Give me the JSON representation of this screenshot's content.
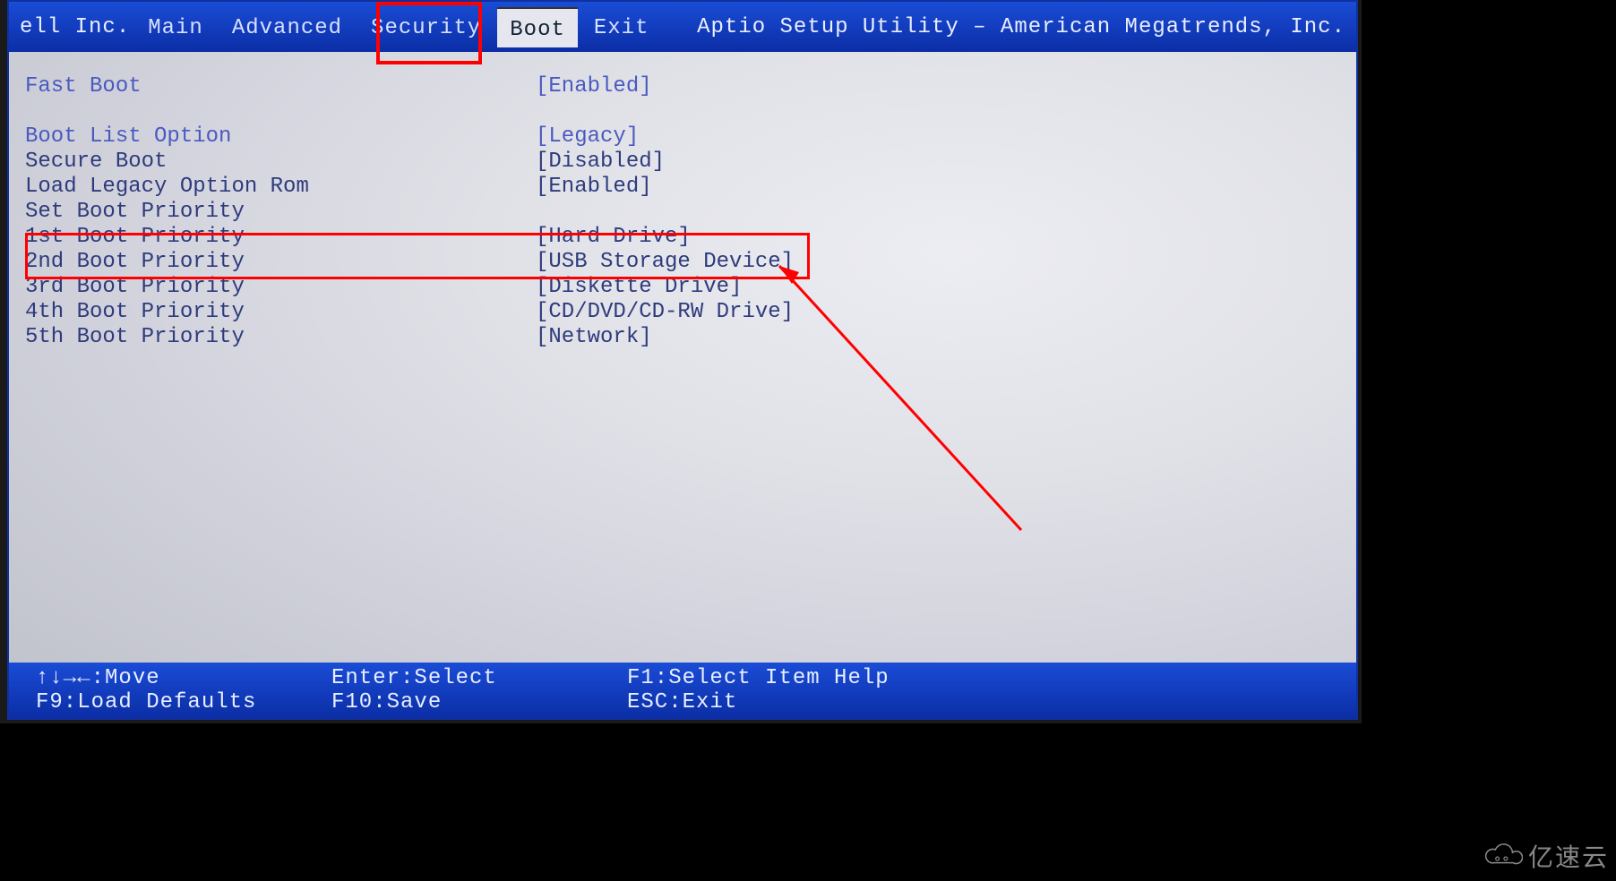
{
  "header": {
    "vendor": "ell Inc.",
    "title": "Aptio Setup Utility – American Megatrends, Inc.",
    "tabs": [
      {
        "label": "Main",
        "active": false
      },
      {
        "label": "Advanced",
        "active": false
      },
      {
        "label": "Security",
        "active": false
      },
      {
        "label": "Boot",
        "active": true
      },
      {
        "label": "Exit",
        "active": false
      }
    ]
  },
  "settings": [
    {
      "label": "Fast Boot",
      "value": "[Enabled]",
      "highlight": true
    },
    {
      "spacer": true
    },
    {
      "label": "Boot List Option",
      "value": "[Legacy]",
      "highlight": true
    },
    {
      "label": "Secure Boot",
      "value": "[Disabled]"
    },
    {
      "label": "Load Legacy Option Rom",
      "value": "[Enabled]"
    },
    {
      "label": "Set Boot Priority",
      "value": ""
    },
    {
      "label": "1st Boot Priority",
      "value": "[Hard Drive]"
    },
    {
      "label": "2nd Boot Priority",
      "value": "[USB Storage Device]"
    },
    {
      "label": "3rd Boot Priority",
      "value": "[Diskette Drive]"
    },
    {
      "label": "4th Boot Priority",
      "value": "[CD/DVD/CD-RW Drive]"
    },
    {
      "label": "5th Boot Priority",
      "value": "[Network]"
    }
  ],
  "footer": {
    "row1": {
      "c1": "↑↓→←:Move",
      "c2": "Enter:Select",
      "c3": "F1:Select Item Help"
    },
    "row2": {
      "c1": "F9:Load Defaults",
      "c2": "F10:Save",
      "c3": "ESC:Exit"
    }
  },
  "watermark": "亿速云"
}
